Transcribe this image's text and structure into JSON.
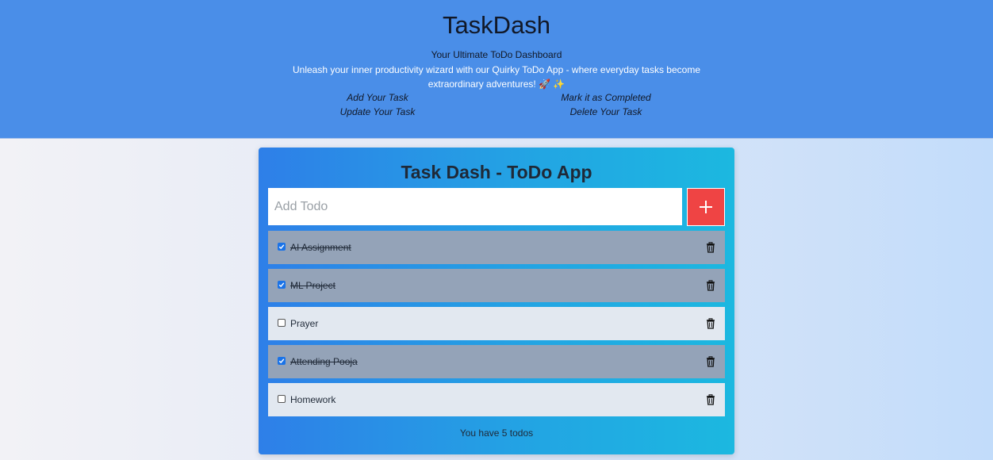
{
  "header": {
    "title": "TaskDash",
    "subtitle": "Your Ultimate ToDo Dashboard",
    "description": "Unleash your inner productivity wizard with our Quirky ToDo App - where everyday tasks become extraordinary adventures! 🚀 ✨",
    "features": [
      "Add Your Task",
      "Mark it as Completed",
      "Update Your Task",
      "Delete Your Task"
    ]
  },
  "app": {
    "title": "Task Dash - ToDo App",
    "input_placeholder": "Add Todo",
    "input_value": "",
    "add_icon": "plus-icon",
    "delete_icon": "trash-icon",
    "todos": [
      {
        "label": "AI Assignment",
        "completed": true
      },
      {
        "label": "ML Project",
        "completed": true
      },
      {
        "label": "Prayer",
        "completed": false
      },
      {
        "label": "Attending Pooja",
        "completed": true
      },
      {
        "label": "Homework",
        "completed": false
      }
    ],
    "count_text": "You have 5 todos"
  },
  "colors": {
    "header_bg": "#4a8ee8",
    "add_button": "#ef4444",
    "done_item": "#94a3b8",
    "open_item": "#e2e8f0"
  }
}
